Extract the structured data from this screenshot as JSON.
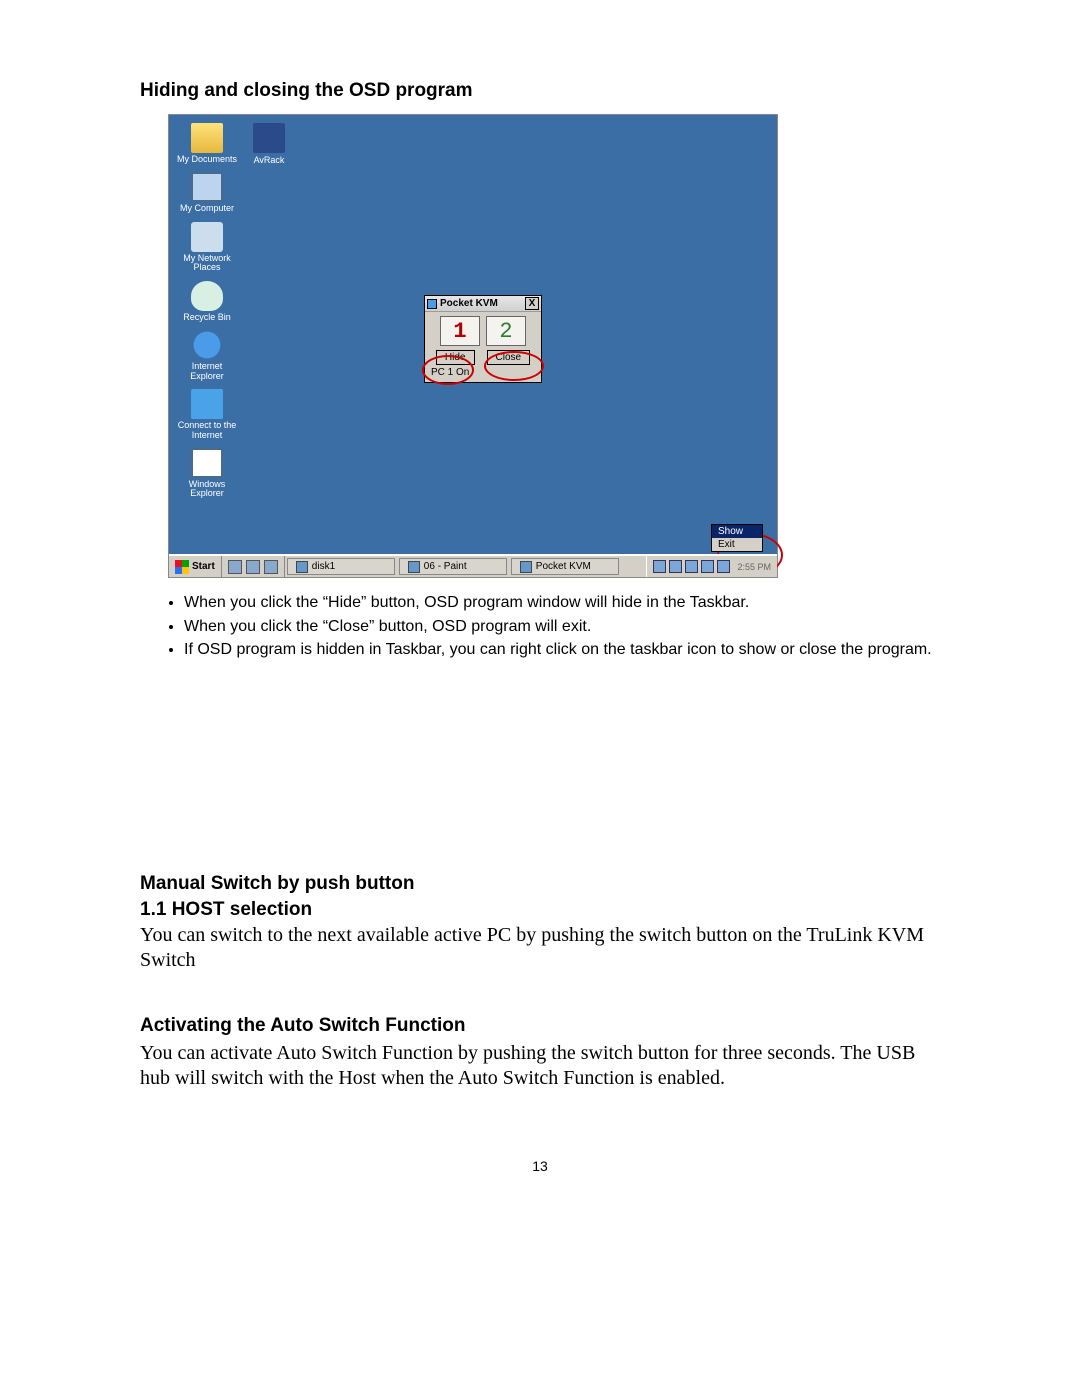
{
  "doc": {
    "heading1": "Hiding and closing the OSD program",
    "bullets": [
      "When you click the “Hide” button, OSD program window will hide in the Taskbar.",
      "When you click the “Close” button, OSD program will exit.",
      "If OSD program is hidden in Taskbar, you can right click on the taskbar icon to show or close the program."
    ],
    "heading2": "Manual Switch by push button",
    "sub1": "1.1 HOST selection",
    "para1": "You can switch to the next available active PC by pushing the switch button on the TruLink KVM Switch",
    "heading3": "Activating the Auto Switch Function",
    "para2": "You can activate Auto Switch Function by pushing the switch button for three seconds. The USB hub will switch with the Host when the Auto Switch Function is enabled.",
    "pageNumber": "13"
  },
  "desktop": {
    "icons": [
      {
        "label": "My Documents"
      },
      {
        "label": "My Computer"
      },
      {
        "label": "My Network Places"
      },
      {
        "label": "Recycle Bin"
      },
      {
        "label": "Internet Explorer"
      },
      {
        "label": "Connect to the Internet"
      },
      {
        "label": "Windows Explorer"
      }
    ],
    "extraIcon": {
      "label": "AvRack"
    }
  },
  "kvm": {
    "title": "Pocket KVM",
    "close_x": "X",
    "num1": "1",
    "num2": "2",
    "hide": "Hide",
    "close": "Close",
    "status": "PC 1 On"
  },
  "trayMenu": {
    "show": "Show",
    "exit": "Exit"
  },
  "taskbar": {
    "start": "Start",
    "items": [
      {
        "label": "disk1"
      },
      {
        "label": "06 - Paint"
      },
      {
        "label": "Pocket KVM"
      }
    ],
    "clock": "2:55 PM"
  }
}
